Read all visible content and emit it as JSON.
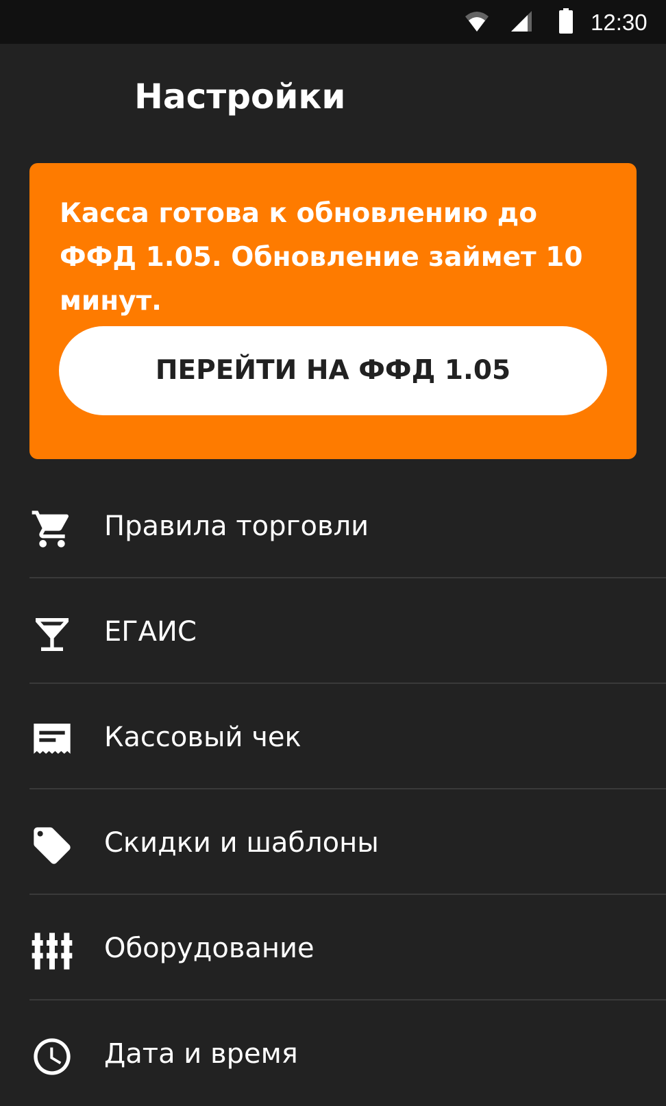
{
  "status_bar": {
    "time": "12:30",
    "icons": [
      "wifi-icon",
      "signal-icon",
      "battery-icon"
    ]
  },
  "header": {
    "title": "Настройки"
  },
  "update_card": {
    "message": "Касса готова к обновлению до ФФД 1.05. Обновление займет 10 минут.",
    "button_label": "ПЕРЕЙТИ НА ФФД 1.05",
    "background_color": "#fe7b00",
    "button_color": "#ffffff"
  },
  "menu": {
    "items": [
      {
        "label": "Правила торговли",
        "icon": "cart-icon"
      },
      {
        "label": "ЕГАИС",
        "icon": "cocktail-glass-icon"
      },
      {
        "label": "Кассовый чек",
        "icon": "receipt-icon"
      },
      {
        "label": "Скидки и шаблоны",
        "icon": "tag-icon"
      },
      {
        "label": "Оборудование",
        "icon": "equalizer-icon"
      },
      {
        "label": "Дата и время",
        "icon": "clock-icon"
      }
    ]
  },
  "colors": {
    "background": "#222222",
    "status_bar": "#111111",
    "accent": "#fe7b00",
    "text": "#ffffff",
    "divider": "#3a3a3a"
  }
}
